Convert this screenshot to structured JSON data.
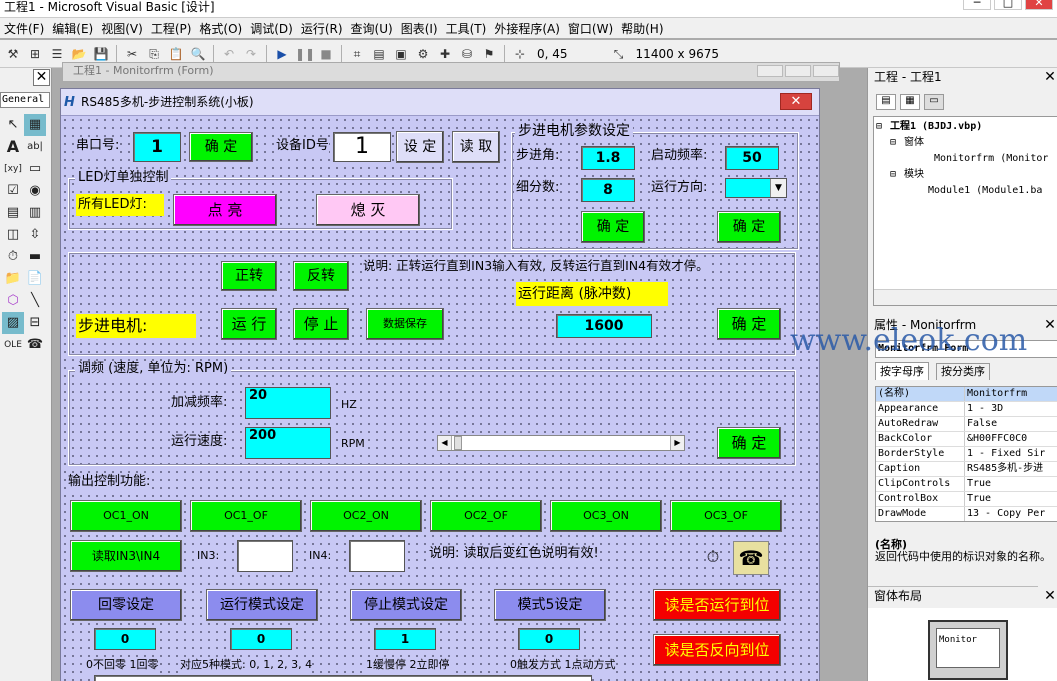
{
  "window": {
    "title": "工程1 - Microsoft Visual Basic [设计]",
    "ctl_min": "─",
    "ctl_max": "□",
    "ctl_close": "✕"
  },
  "menu": [
    "文件(F)",
    "编辑(E)",
    "视图(V)",
    "工程(P)",
    "格式(O)",
    "调试(D)",
    "运行(R)",
    "查询(U)",
    "图表(I)",
    "工具(T)",
    "外接程序(A)",
    "窗口(W)",
    "帮助(H)"
  ],
  "toolbar": {
    "position": "0, 45",
    "size": "11400 x 9675"
  },
  "toolbox": {
    "general": "General",
    "close": "✕"
  },
  "mdi": {
    "title": "工程1 - Monitorfrm (Form)"
  },
  "form": {
    "title": "RS485多机-步进控制系统(小板)",
    "close": "✕",
    "serial": {
      "label": "串口号:",
      "value": "1",
      "ok": "确 定"
    },
    "device": {
      "label": "设备ID号",
      "value": "1",
      "set": "设 定",
      "read": "读 取"
    },
    "led": {
      "frame": "LED灯单独控制",
      "label": "所有LED灯:",
      "on": "点 亮",
      "off": "熄 灭"
    },
    "stepper_params": {
      "frame": "步进电机参数设定",
      "step_angle_label": "步进角:",
      "step_angle": "1.8",
      "start_freq_label": "启动频率:",
      "start_freq": "50",
      "subdiv_label": "细分数:",
      "subdiv": "8",
      "direction_label": "运行方向:",
      "ok1": "确 定",
      "ok2": "确 定"
    },
    "motor": {
      "forward": "正转",
      "reverse": "反转",
      "note": "说明: 正转运行直到IN3输入有效, 反转运行直到IN4有效才停。",
      "label": "步进电机:",
      "run": "运 行",
      "stop": "停 止",
      "save": "数据保存",
      "distance_label": "运行距离 (脉冲数)",
      "distance": "1600",
      "ok": "确 定"
    },
    "freq": {
      "frame": "调频 (速度, 单位为: RPM)",
      "accel_label": "加减频率:",
      "accel": "20",
      "accel_unit": "HZ",
      "speed_label": "运行速度:",
      "speed": "200",
      "speed_unit": "RPM",
      "ok": "确 定"
    },
    "output": {
      "label": "输出控制功能:",
      "buttons": [
        "OC1_ON",
        "OC1_OF",
        "OC2_ON",
        "OC2_OF",
        "OC3_ON",
        "OC3_OF"
      ],
      "read_in": "读取IN3\\IN4",
      "in3_label": "IN3:",
      "in4_label": "IN4:",
      "note": "说明: 读取后变红色说明有效!"
    },
    "modes": {
      "homing": "回零设定",
      "run_mode": "运行模式设定",
      "stop_mode": "停止模式设定",
      "mode5": "模式5设定",
      "check_fwd": "读是否运行到位",
      "check_rev": "读是否反向到位",
      "homing_val": "0",
      "run_mode_val": "0",
      "stop_mode_val": "1",
      "mode5_val": "0",
      "homing_note": "0不回零 1回零",
      "run_mode_note": "对应5种模式: 0, 1, 2, 3, 4",
      "stop_mode_note": "1缓慢停 2立即停",
      "mode5_note": "0触发方式 1点动方式"
    }
  },
  "project": {
    "title": "工程 - 工程1",
    "close": "✕",
    "tree": [
      "工程1 (BJDJ.vbp)",
      "窗体",
      "Monitorfrm (Monitor",
      "模块",
      "Module1 (Module1.ba"
    ],
    "tree_markers": [
      "⊟",
      "⊟",
      "⊟"
    ]
  },
  "properties": {
    "title": "属性 - Monitorfrm",
    "close": "✕",
    "combo": "Monitorfrm Form",
    "tab_alpha": "按字母序",
    "tab_cat": "按分类序",
    "rows": [
      [
        "(名称)",
        "Monitorfrm"
      ],
      [
        "Appearance",
        "1 - 3D"
      ],
      [
        "AutoRedraw",
        "False"
      ],
      [
        "BackColor",
        "&H00FFC0C0"
      ],
      [
        "BorderStyle",
        "1 - Fixed Sir"
      ],
      [
        "Caption",
        "RS485多机-步进"
      ],
      [
        "ClipControls",
        "True"
      ],
      [
        "ControlBox",
        "True"
      ],
      [
        "DrawMode",
        "13 - Copy Per"
      ]
    ],
    "desc_title": "(名称)",
    "desc_text": "返回代码中使用的标识对象的名称。"
  },
  "layout_win": {
    "title": "窗体布局",
    "close": "✕",
    "thumb": "Monitor"
  },
  "watermark": "www.eleok.com",
  "colors": {
    "form_bg": "#c8c8f4",
    "button_green": "#00f400",
    "button_purple": "#8c8cee",
    "button_red": "#f40000",
    "field_cyan": "#00ffff"
  }
}
